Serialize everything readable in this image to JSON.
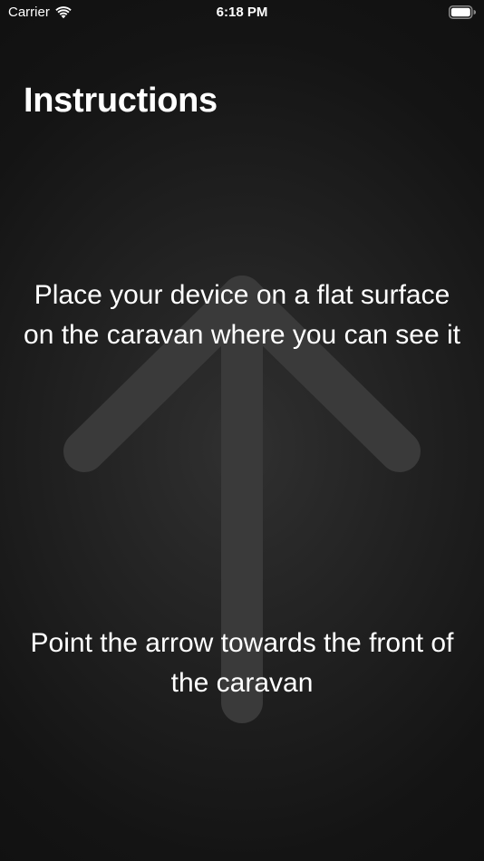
{
  "status_bar": {
    "carrier": "Carrier",
    "time": "6:18 PM",
    "icons": [
      "wifi-icon",
      "battery-icon"
    ]
  },
  "title": "Instructions",
  "instructions": [
    "Place your device on a flat surface on the caravan where you can see it",
    "Point the arrow towards the front of the caravan"
  ],
  "graphic": {
    "icon": "up-arrow-icon",
    "color": "#3a3a3a"
  },
  "colors": {
    "background": "#141414",
    "text": "#ffffff"
  }
}
